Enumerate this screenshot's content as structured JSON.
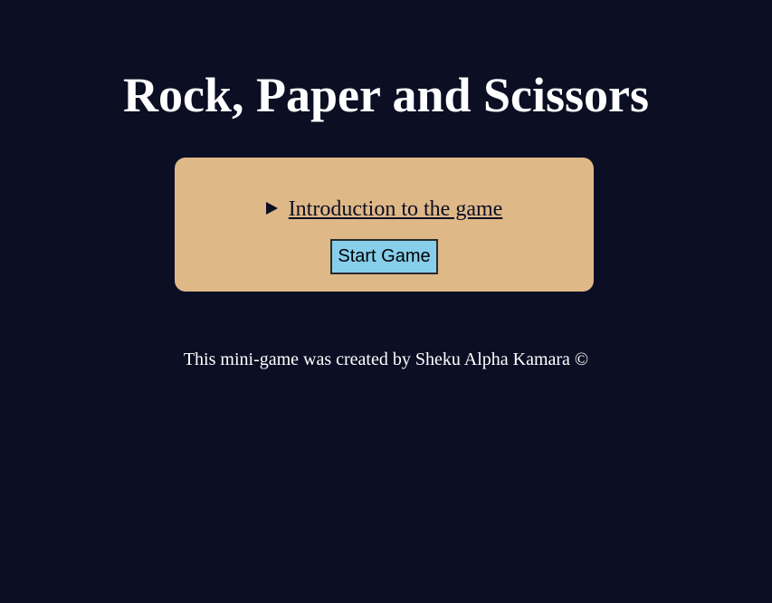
{
  "page": {
    "title": "Rock, Paper and Scissors"
  },
  "panel": {
    "intro_label": "Introduction to the game",
    "intro_expanded": false,
    "start_button_label": "Start Game"
  },
  "footer": {
    "text": "This mini-game was created by Sheku Alpha Kamara ©"
  },
  "colors": {
    "background": "#0c0e24",
    "panel": "#deb887",
    "button": "#87ceeb",
    "text": "#ffffff"
  },
  "icons": {
    "disclosure": "disclosure-triangle-icon"
  }
}
